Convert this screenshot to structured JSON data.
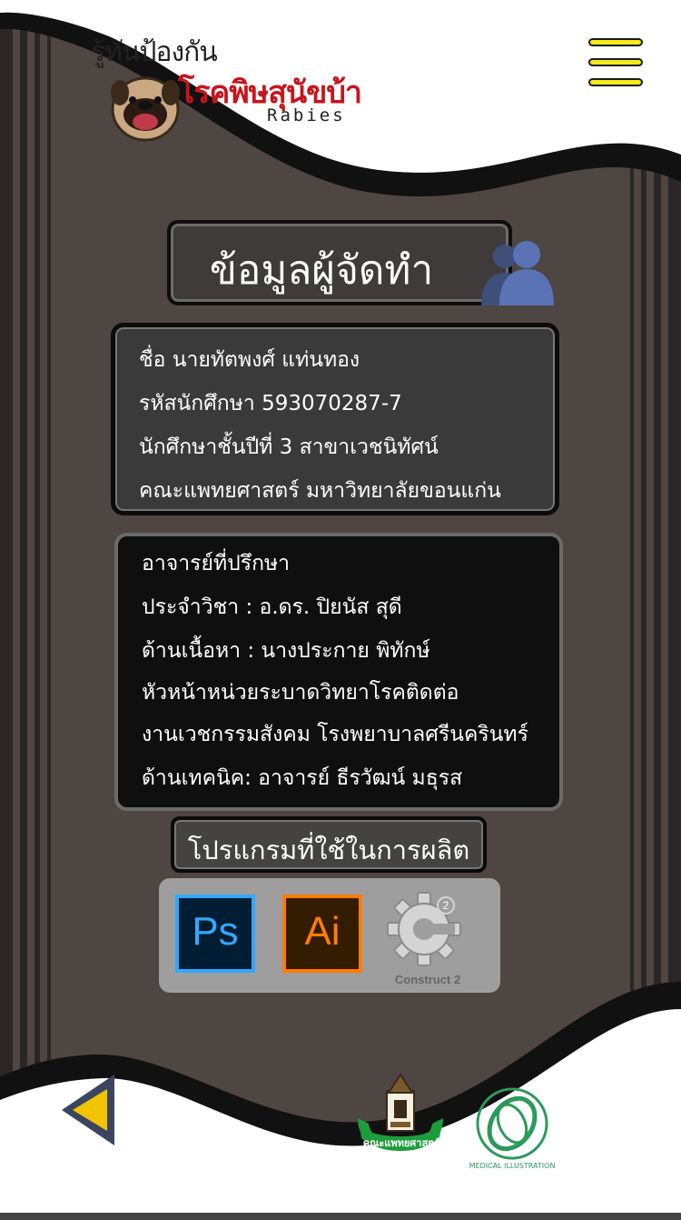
{
  "header": {
    "logo_small": "รู้ทันป้องกัน",
    "logo_big": "โรคพิษสุนัขบ้า",
    "logo_en": "Rabies",
    "menu_icon": "hamburger-icon"
  },
  "page": {
    "title": "ข้อมูลผู้จัดทำ",
    "title_icon": "people-icon"
  },
  "author": {
    "lines": [
      "ชื่อ นายทัตพงศ์ แท่นทอง",
      "รหัสนักศึกษา 593070287-7",
      "นักศึกษาชั้นปีที่ 3 สาขาเวชนิทัศน์",
      "คณะแพทยศาสตร์ มหาวิทยาลัยขอนแก่น"
    ]
  },
  "advisors": {
    "lines": [
      "อาจารย์ที่ปรึกษา",
      "ประจำวิชา : อ.ดร. ปิยนัส สุดี",
      "ด้านเนื้อหา : นางประกาย พิทักษ์",
      "หัวหน้าหน่วยระบาดวิทยาโรคติดต่อ",
      "งานเวชกรรมสังคม โรงพยาบาลศรีนครินทร์",
      "ด้านเทคนิค: อาจารย์ ธีรวัฒน์ มธุรส"
    ]
  },
  "software": {
    "title": "โปรแกรมที่ใช้ในการผลิต",
    "photoshop": "Ps",
    "illustrator": "Ai",
    "construct": "Construct 2"
  },
  "footer": {
    "back_icon": "back-arrow-icon",
    "seal_text": "คณะแพทยศาสตร์",
    "mi_text": "MEDICAL ILLUSTRATION"
  },
  "colors": {
    "background": "#4e4643",
    "logo_red": "#c8141b",
    "menu_yellow": "#f7ea1a",
    "back_yellow": "#f2c400",
    "seal_green": "#1c9c3a"
  }
}
